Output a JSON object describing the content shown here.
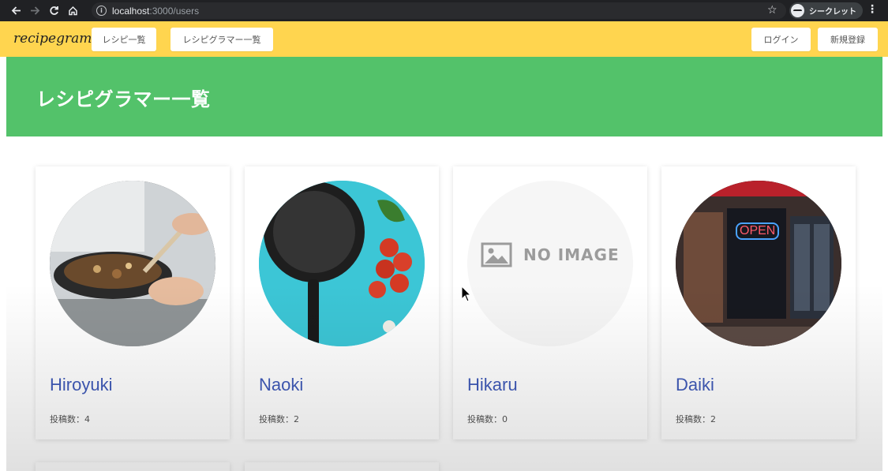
{
  "browser": {
    "url_host": "localhost",
    "url_rest": ":3000/users",
    "profile_label": "シークレット",
    "icons": [
      "back-icon",
      "forward-icon",
      "reload-icon",
      "home-icon",
      "info-icon",
      "star-icon",
      "incognito-icon",
      "menu-kebab-icon"
    ]
  },
  "navbar": {
    "brand": "recipegram",
    "links": [
      "レシピ一覧",
      "レシピグラマー一覧"
    ],
    "login": "ログイン",
    "signup": "新規登録"
  },
  "hero": {
    "title": "レシピグラマー一覧"
  },
  "users": [
    {
      "name": "Hiroyuki",
      "posts": "投稿数：4",
      "image": "cooking-pan-photo"
    },
    {
      "name": "Naoki",
      "posts": "投稿数：2",
      "image": "frying-pan-tomatoes-photo"
    },
    {
      "name": "Hikaru",
      "posts": "投稿数：0",
      "image": "no-image-placeholder",
      "placeholder_text": "NO IMAGE"
    },
    {
      "name": "Daiki",
      "posts": "投稿数：2",
      "image": "restaurant-open-sign-photo",
      "sign_text": "OPEN"
    }
  ],
  "colors": {
    "navbar": "#ffd54f",
    "hero": "#53c26a",
    "username": "#3f5ab8",
    "chrome": "#202124"
  }
}
